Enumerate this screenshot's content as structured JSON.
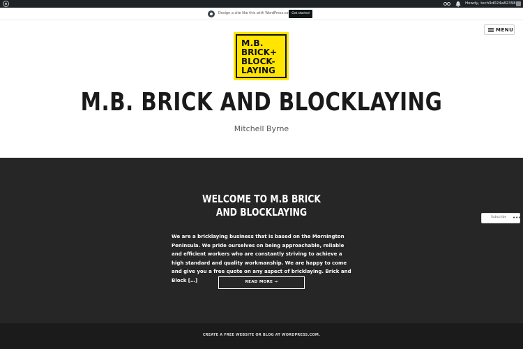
{
  "admin_bar": {
    "howdy": "Howdy, tech9d024a82398"
  },
  "promo": {
    "text": "Design a site like this with WordPress.com",
    "button": "Get started"
  },
  "header": {
    "menu_label": "MENU",
    "logo_lines": [
      "M.B.",
      "BRICK+",
      "BLOCK-",
      "LAYING"
    ],
    "site_title": "M.B. BRICK AND BLOCKLAYING",
    "tagline": "Mitchell Byrne"
  },
  "post": {
    "title_line1": "WELCOME TO M.B BRICK",
    "title_line2": "AND BLOCKLAYING",
    "excerpt": "We are a bricklaying business that is based on the Mornington Peninsula. We pride ourselves on being approachable, reliable and efficient workers who are constantly striving to achieve a high standard and quality workmanship.   We are happy to come and give you a free quote on any aspect of bricklaying.   Brick and Block […]",
    "read_more": "READ MORE →"
  },
  "subscribe": {
    "label": "Subscribe",
    "more": "•••"
  },
  "footer": {
    "link": "CREATE A FREE WEBSITE OR BLOG AT WORDPRESS.COM."
  },
  "colors": {
    "logo_yellow": "#ffe500",
    "content_bg": "#262626",
    "footer_bg": "#1b1b1b",
    "admin_bar_bg": "#1d2327"
  }
}
